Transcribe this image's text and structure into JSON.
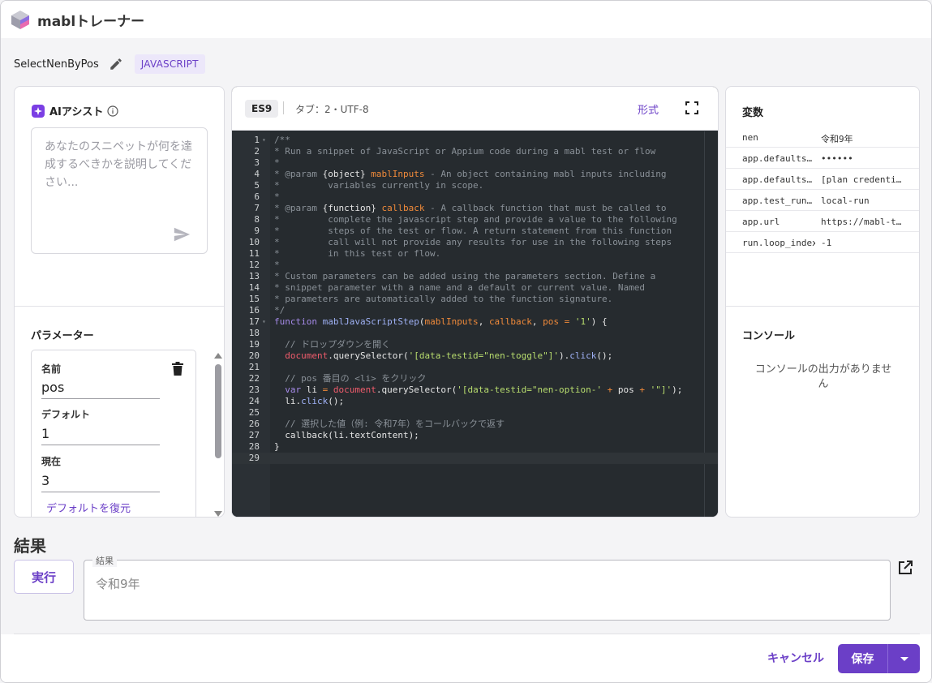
{
  "app": {
    "title": "mablトレーナー"
  },
  "snippet": {
    "name": "SelectNenByPos",
    "language": "JAVASCRIPT"
  },
  "ai_assist": {
    "title": "AIアシスト",
    "placeholder": "あなたのスニペットが何を達成するべきかを説明してください..."
  },
  "parameters": {
    "title": "パラメーター",
    "name_label": "名前",
    "name_value": "pos",
    "default_label": "デフォルト",
    "default_value": "1",
    "current_label": "現在",
    "current_value": "3",
    "restore_label": "デフォルトを復元"
  },
  "editor": {
    "es_badge": "ES9",
    "meta": "タブ：2・UTF-8",
    "format_label": "形式",
    "code": [
      "/**",
      "* Run a snippet of JavaScript or Appium code during a mabl test or flow",
      "*",
      "* @param {object} mablInputs - An object containing mabl inputs including",
      "*         variables currently in scope.",
      "*",
      "* @param {function} callback - A callback function that must be called to",
      "*         complete the javascript step and provide a value to the following",
      "*         steps of the test or flow. A return statement from this function",
      "*         call will not provide any results for use in the following steps",
      "*         in this test or flow.",
      "*",
      "* Custom parameters can be added using the parameters section. Define a",
      "* snippet parameter with a name and a default or current value. Named",
      "* parameters are automatically added to the function signature.",
      "*/",
      "function mablJavaScriptStep(mablInputs, callback, pos = '1') {",
      "",
      "  // ドロップダウンを開く",
      "  document.querySelector('[data-testid=\"nen-toggle\"]').click();",
      "",
      "  // pos 番目の <li> をクリック",
      "  var li = document.querySelector('[data-testid=\"nen-option-' + pos + '\"]');",
      "  li.click();",
      "",
      "  // 選択した値（例: 令和7年）をコールバックで返す",
      "  callback(li.textContent);",
      "}",
      ""
    ]
  },
  "variables": {
    "title": "変数",
    "rows": [
      {
        "key": "nen",
        "value": "令和9年"
      },
      {
        "key": "app.defaults…",
        "value": "••••••"
      },
      {
        "key": "app.defaults…",
        "value": "[plan credenti…"
      },
      {
        "key": "app.test_run…",
        "value": "local-run"
      },
      {
        "key": "app.url",
        "value": "https://mabl-t…"
      },
      {
        "key": "run.loop_index",
        "value": "-1"
      }
    ]
  },
  "console": {
    "title": "コンソール",
    "empty": "コンソールの出力がありません"
  },
  "results": {
    "title": "結果",
    "run_label": "実行",
    "field_label": "結果",
    "value": "令和9年"
  },
  "footer": {
    "cancel_label": "キャンセル",
    "save_label": "保存"
  },
  "colors": {
    "accent": "#6b3fc7",
    "editor_bg": "#262b2f"
  }
}
